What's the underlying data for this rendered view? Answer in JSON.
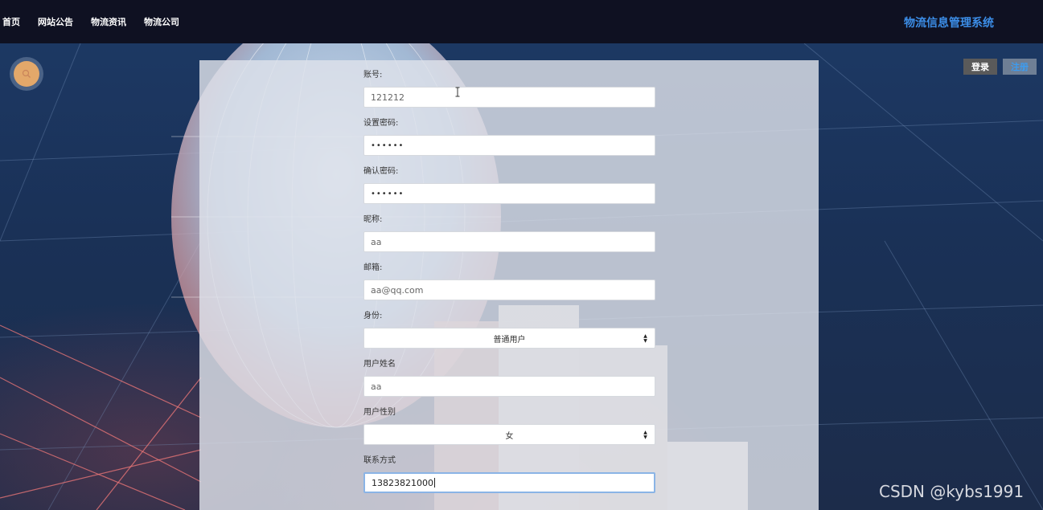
{
  "nav": {
    "items": [
      {
        "label": "首页"
      },
      {
        "label": "网站公告"
      },
      {
        "label": "物流资讯"
      },
      {
        "label": "物流公司"
      }
    ],
    "site_title": "物流信息管理系统"
  },
  "auth": {
    "login_label": "登录",
    "register_label": "注册"
  },
  "form": {
    "account": {
      "label": "账号:",
      "value": "121212"
    },
    "password": {
      "label": "设置密码:",
      "value": "••••••"
    },
    "confirm_password": {
      "label": "确认密码:",
      "value": "••••••"
    },
    "nickname": {
      "label": "昵称:",
      "value": "aa"
    },
    "email": {
      "label": "邮箱:",
      "value": "aa@qq.com"
    },
    "identity": {
      "label": "身份:",
      "selected": "普通用户"
    },
    "real_name": {
      "label": "用户姓名",
      "value": "aa"
    },
    "gender": {
      "label": "用户性别",
      "selected": "女"
    },
    "contact": {
      "label": "联系方式",
      "value": "13823821000"
    }
  },
  "watermark": "CSDN @kybs1991",
  "colors": {
    "topbar": "#0f1122",
    "site_title": "#3c8ee8",
    "search_button": "#e3a86a",
    "login_button": "#5a5a5a",
    "register_text": "#3d9cf0"
  },
  "icons": {
    "search": "search-icon",
    "select_arrows": "sort-arrows-icon",
    "text_cursor": "ibeam-cursor-icon"
  }
}
